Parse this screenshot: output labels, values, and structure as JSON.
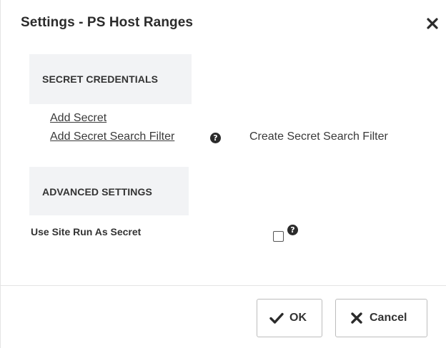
{
  "dialog": {
    "title": "Settings - PS Host Ranges",
    "close_icon": "close-icon"
  },
  "secret_credentials": {
    "heading": "SECRET CREDENTIALS",
    "add_secret_link": "Add Secret",
    "add_secret_search_filter_link": "Add Secret Search Filter",
    "help_icon": "question-circle-icon",
    "create_filter_text": "Create Secret Search Filter"
  },
  "advanced_settings": {
    "heading": "ADVANCED SETTINGS",
    "use_site_run_as_secret_label": "Use Site Run As Secret",
    "use_site_run_as_secret_checked": false,
    "help_icon": "question-circle-icon"
  },
  "footer": {
    "ok_label": "OK",
    "ok_icon": "checkmark-icon",
    "cancel_label": "Cancel",
    "cancel_icon": "x-icon"
  },
  "colors": {
    "section_background": "#f2f3f5",
    "text": "#333333",
    "border": "#bdbdbd"
  }
}
